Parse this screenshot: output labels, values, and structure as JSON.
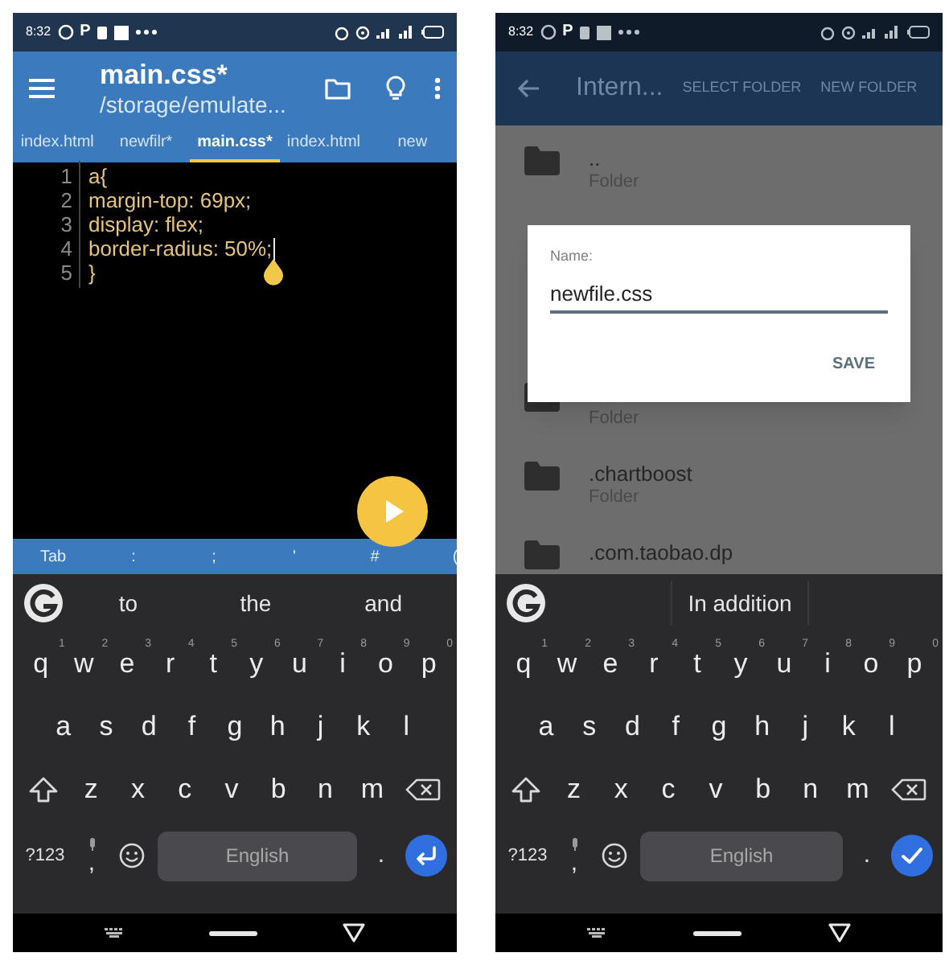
{
  "phones": [
    {
      "kind": "editor",
      "status_bar": {
        "time": "8:32",
        "letter": "P"
      },
      "app_bar": {
        "title": "main.css*",
        "subtitle": "/storage/emulate..."
      },
      "tabs": [
        {
          "label": "index.html",
          "selected": false
        },
        {
          "label": "newfilr*",
          "selected": false
        },
        {
          "label": "main.css*",
          "selected": true
        },
        {
          "label": "index.html",
          "selected": false
        },
        {
          "label": "new",
          "selected": false
        }
      ],
      "code": [
        {
          "number": "1",
          "text": "a{",
          "cursor": false
        },
        {
          "number": "2",
          "text": "margin-top: 69px;",
          "cursor": false
        },
        {
          "number": "3",
          "text": "display: flex;",
          "cursor": false
        },
        {
          "number": "4",
          "text": "border-radius: 50%;",
          "cursor": true
        },
        {
          "number": "5",
          "text": "}",
          "cursor": false
        }
      ],
      "symbols": [
        "Tab",
        ":",
        ";",
        "'",
        "#",
        "("
      ],
      "keyboard": {
        "suggestions": [
          {
            "text": "to"
          },
          {
            "text": "the"
          },
          {
            "text": "and"
          }
        ],
        "hints": [
          "1",
          "2",
          "3",
          "4",
          "5",
          "6",
          "7",
          "8",
          "9",
          "0"
        ],
        "rows": [
          [
            "q",
            "w",
            "e",
            "r",
            "t",
            "y",
            "u",
            "i",
            "o",
            "p"
          ],
          [
            "a",
            "s",
            "d",
            "f",
            "g",
            "h",
            "j",
            "k",
            "l"
          ],
          [
            "z",
            "x",
            "c",
            "v",
            "b",
            "n",
            "m"
          ]
        ],
        "symbols_key": "?123",
        "comma": ",",
        "space": "English",
        "period": ".",
        "action": {
          "kind": "enter"
        }
      }
    },
    {
      "kind": "file_picker",
      "status_bar": {
        "time": "8:32",
        "letter": "P"
      },
      "app_bar": {
        "title": "Intern...",
        "actions": [
          "SELECT FOLDER",
          "NEW FOLDER"
        ]
      },
      "folders": [
        {
          "name": "..",
          "type": "Folder"
        },
        {
          "type": "Folder"
        },
        {
          "name": ".chartboost",
          "type": "Folder"
        },
        {
          "name": ".com.taobao.dp"
        }
      ],
      "dialog": {
        "label": "Name:",
        "value": "newfile.css",
        "button": "SAVE"
      },
      "keyboard": {
        "suggestions": [
          {
            "text": "In addition"
          }
        ],
        "hints": [
          "1",
          "2",
          "3",
          "4",
          "5",
          "6",
          "7",
          "8",
          "9",
          "0"
        ],
        "rows": [
          [
            "q",
            "w",
            "e",
            "r",
            "t",
            "y",
            "u",
            "i",
            "o",
            "p"
          ],
          [
            "a",
            "s",
            "d",
            "f",
            "g",
            "h",
            "j",
            "k",
            "l"
          ],
          [
            "z",
            "x",
            "c",
            "v",
            "b",
            "n",
            "m"
          ]
        ],
        "symbols_key": "?123",
        "comma": ",",
        "space": "English",
        "period": ".",
        "action": {
          "kind": "done"
        }
      }
    }
  ]
}
